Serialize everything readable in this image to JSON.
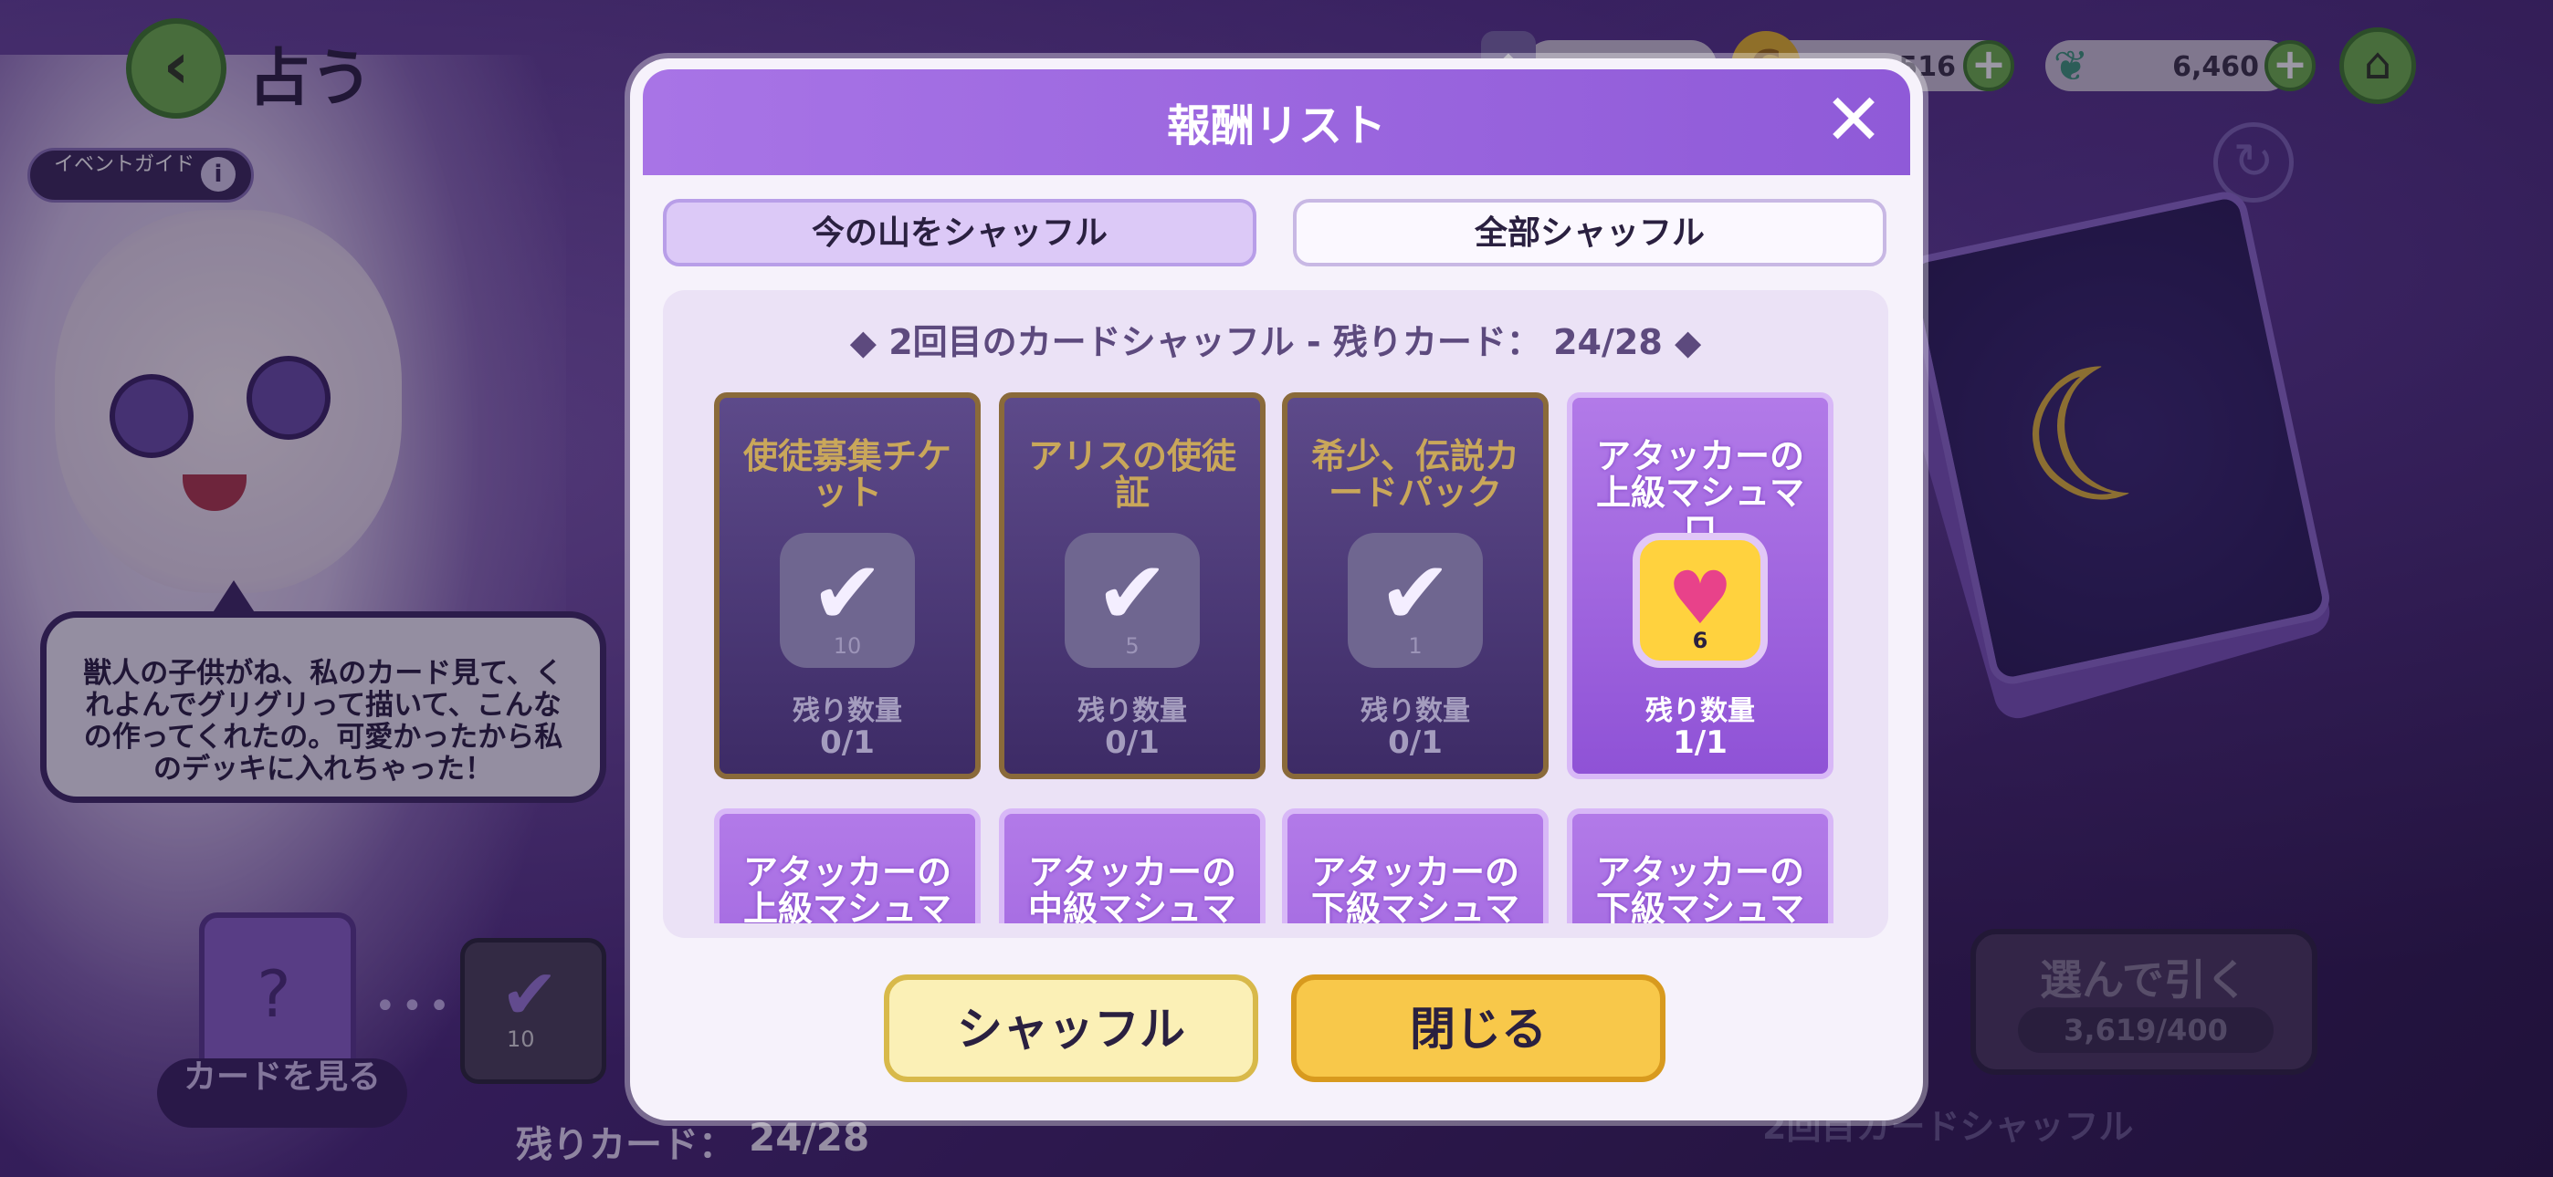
{
  "header": {
    "title": "占う",
    "back_icon": "chevron-left-icon",
    "event_guide": "イベントガイド"
  },
  "currencies": [
    {
      "icon": "card-icon",
      "value": ""
    },
    {
      "icon": "coin-icon",
      "value": "516"
    },
    {
      "icon": "leaf-icon",
      "value": "6,460"
    }
  ],
  "speech": "獣人の子供がね、私のカード見て、くれよんでグリグリって描いて、こんなの作ってくれたの。可愛かったから私のデッキに入れちゃった！",
  "view_cards": "カードを見る",
  "deck_mini_count": "10",
  "remaining_cards_label": "残りカード：",
  "remaining_cards_value": "24/28",
  "draw_button": {
    "label": "選んで引く",
    "cost": "3,619/400"
  },
  "bottom_shuffle_label": "2回目カードシャッフル",
  "modal": {
    "title": "報酬リスト",
    "tabs": [
      {
        "label": "今の山をシャッフル"
      },
      {
        "label": "全部シャッフル"
      }
    ],
    "panel_title": "◆ 2回目のカードシャッフル - 残りカード： 24/28 ◆",
    "rewards": [
      {
        "name": "使徒募集チケット",
        "qty": "10",
        "label": "残り数量",
        "count": "0/1",
        "state": "got"
      },
      {
        "name": "アリスの使徒証",
        "qty": "5",
        "label": "残り数量",
        "count": "0/1",
        "state": "got"
      },
      {
        "name": "希少、伝説カードパック",
        "qty": "1",
        "label": "残り数量",
        "count": "0/1",
        "state": "got"
      },
      {
        "name": "アタッカーの上級マシュマロ",
        "qty": "6",
        "label": "残り数量",
        "count": "1/1",
        "state": "avail"
      },
      {
        "name": "アタッカーの上級マシュマロ",
        "qty": "",
        "label": "",
        "count": "",
        "state": "avail"
      },
      {
        "name": "アタッカーの中級マシュマロ",
        "qty": "",
        "label": "",
        "count": "",
        "state": "avail"
      },
      {
        "name": "アタッカーの下級マシュマロ",
        "qty": "",
        "label": "",
        "count": "",
        "state": "avail"
      },
      {
        "name": "アタッカーの下級マシュマロ",
        "qty": "",
        "label": "",
        "count": "",
        "state": "avail"
      }
    ],
    "buttons": {
      "shuffle": "シャッフル",
      "close": "閉じる"
    }
  }
}
